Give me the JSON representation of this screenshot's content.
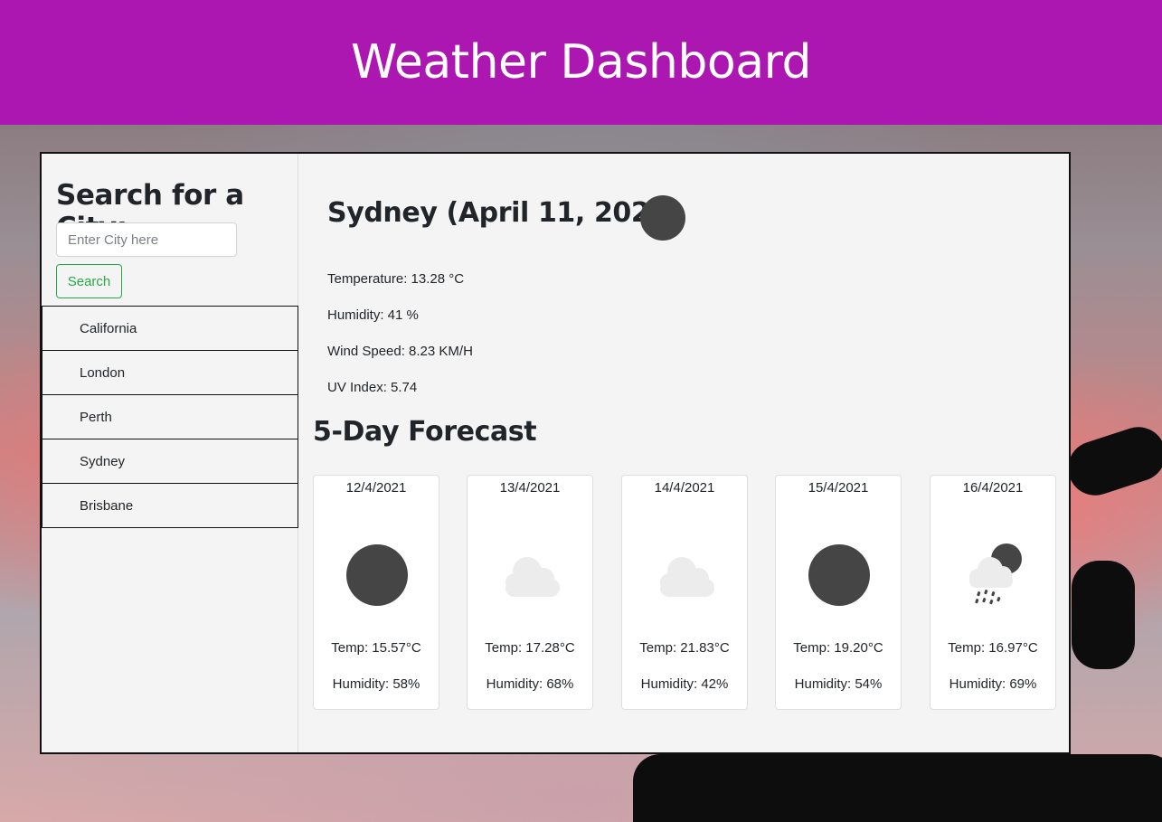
{
  "header": {
    "title": "Weather Dashboard"
  },
  "sidebar": {
    "heading": "Search for a City:",
    "search_placeholder": "Enter City here",
    "search_button": "Search",
    "history": [
      "California",
      "London",
      "Perth",
      "Sydney",
      "Brisbane"
    ]
  },
  "current": {
    "title": "Sydney (April 11, 2021)",
    "icon": "dark-circle-icon",
    "temperature": "Temperature: 13.28 °C",
    "humidity": "Humidity: 41 %",
    "wind": "Wind Speed: 8.23 KM/H",
    "uv": "UV Index: 5.74"
  },
  "forecast": {
    "title": "5-Day Forecast",
    "days": [
      {
        "date": "12/4/2021",
        "icon": "dark-circle-icon",
        "temp": "Temp: 15.57°C",
        "humidity": "Humidity: 58%"
      },
      {
        "date": "13/4/2021",
        "icon": "cloud-icon",
        "temp": "Temp: 17.28°C",
        "humidity": "Humidity: 68%"
      },
      {
        "date": "14/4/2021",
        "icon": "cloud-icon",
        "temp": "Temp: 21.83°C",
        "humidity": "Humidity: 42%"
      },
      {
        "date": "15/4/2021",
        "icon": "dark-circle-icon",
        "temp": "Temp: 19.20°C",
        "humidity": "Humidity: 54%"
      },
      {
        "date": "16/4/2021",
        "icon": "rain-night-icon",
        "temp": "Temp: 16.97°C",
        "humidity": "Humidity: 69%"
      }
    ]
  },
  "colors": {
    "header_bg": "#ad17b1",
    "panel_bg": "#f4f4f4",
    "button_green": "#28a745",
    "icon_dark": "#454545",
    "cloud_light": "#ececec"
  }
}
